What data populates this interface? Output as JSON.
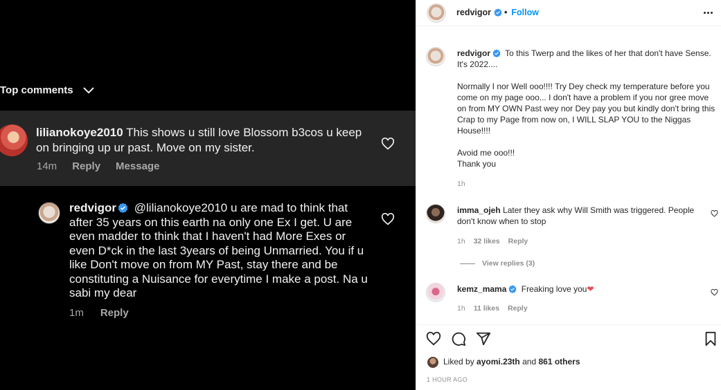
{
  "left_panel": {
    "top_comments_label": "Top comments",
    "comment": {
      "username": "lilianokoye2010",
      "text": "This shows u still love Blossom b3cos u keep on bringing up ur past. Move on my sister.",
      "time": "14m",
      "reply_label": "Reply",
      "message_label": "Message"
    },
    "reply": {
      "username": "redvigor",
      "text": "@lilianokoye2010 u are mad to think that after 35 years on this earth na only one Ex I get. U are even madder to think that I haven't had More Exes or even D*ck in the last 3years of being Unmarried. You if u like Don't move on from MY Past, stay there and be constituting a Nuisance for everytime I make a post. Na u sabi my dear",
      "time": "1m",
      "reply_label": "Reply"
    }
  },
  "post": {
    "header": {
      "username": "redvigor",
      "dot": "•",
      "follow_label": "Follow"
    },
    "caption": {
      "username": "redvigor",
      "para1": "To this Twerp and the likes of her that don't have Sense. It's 2022....",
      "para2": "Normally I nor Well ooo!!!! Try Dey check my temperature before you come on my page ooo... I don't have a problem if you nor gree move on from MY OWN Past wey nor Dey pay you but kindly don't bring this Crap to my Page from now on, I WILL SLAP YOU to the Niggas House!!!!",
      "para3a": "Avoid me ooo!!!",
      "para3b": "Thank you",
      "time": "1h"
    },
    "comments": [
      {
        "username": "imma_ojeh",
        "text": "Later they ask why Will Smith was triggered. People don't know when to stop",
        "time": "1h",
        "likes": "32 likes",
        "reply_label": "Reply"
      },
      {
        "username": "kemz_mama",
        "text": "Freaking love you",
        "emoji": "❤",
        "time": "1h",
        "likes": "11 likes",
        "reply_label": "Reply"
      }
    ],
    "view_replies_label": "View replies (3)",
    "likes": {
      "prefix": "Liked by",
      "user": "ayomi.23th",
      "and": "and",
      "others": "861 others"
    },
    "timestamp": "1 HOUR AGO"
  },
  "colors": {
    "dark_bg": "#000000",
    "dark_highlight": "#262626",
    "accent_blue": "#0095f6",
    "verified_blue": "#3897f0",
    "heart_red": "#ed4956"
  }
}
